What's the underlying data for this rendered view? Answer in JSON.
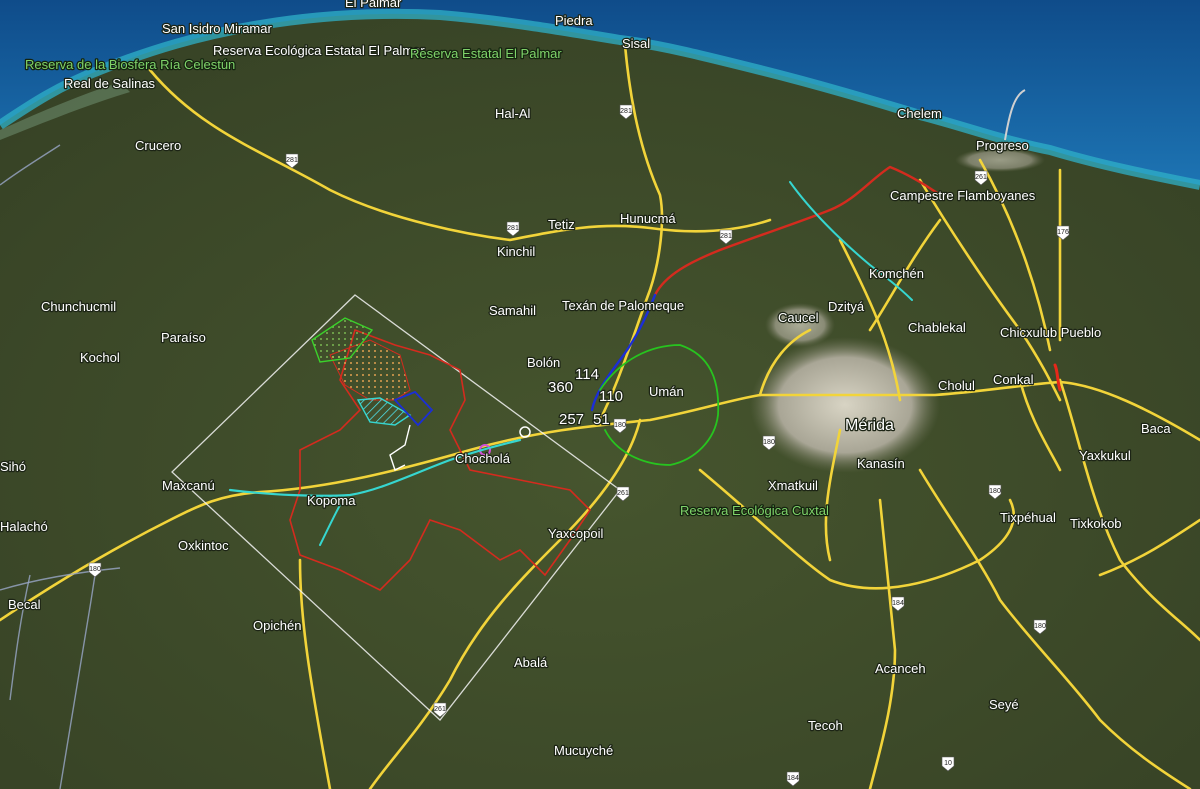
{
  "map": {
    "type": "satellite",
    "colors": {
      "land": "#3d4a2a",
      "sea": "#1a5f9e",
      "coast": "#2a9fc0",
      "road": "#f2d43a",
      "urban": "#c9c6b8",
      "route_red": "#d42b1e",
      "route_blue": "#1b2ed6",
      "route_green": "#27c41f",
      "route_cyan": "#36d6d0",
      "study_area": "#f4f4f4"
    },
    "place_labels": [
      {
        "id": "el-palmar-top",
        "text": "El Palmar"
      },
      {
        "id": "piedra",
        "text": "Piedra"
      },
      {
        "id": "san-isidro",
        "text": "San Isidro Miramar"
      },
      {
        "id": "reserva-el-palmar-ecol",
        "text": "Reserva Ecológica Estatal El Palmar"
      },
      {
        "id": "reserva-estatal-el-palmar",
        "text": "Reserva Estatal El Palmar"
      },
      {
        "id": "sisal",
        "text": "Sisal"
      },
      {
        "id": "reserva-celestun",
        "text": "Reserva de la Biosfera Ría Celestún"
      },
      {
        "id": "real-de-salinas",
        "text": "Real de Salinas"
      },
      {
        "id": "hal-al",
        "text": "Hal-Al"
      },
      {
        "id": "chelem",
        "text": "Chelem"
      },
      {
        "id": "crucero",
        "text": "Crucero"
      },
      {
        "id": "progreso",
        "text": "Progreso"
      },
      {
        "id": "campestre",
        "text": "Campestre Flamboyanes"
      },
      {
        "id": "tetiz",
        "text": "Tetiz"
      },
      {
        "id": "hunucma",
        "text": "Hunucmá"
      },
      {
        "id": "kinchil",
        "text": "Kinchil"
      },
      {
        "id": "komchen",
        "text": "Komchén"
      },
      {
        "id": "chunchucmil",
        "text": "Chunchucmil"
      },
      {
        "id": "samahil",
        "text": "Samahil"
      },
      {
        "id": "texan",
        "text": "Texán de Palomeque"
      },
      {
        "id": "dzitya",
        "text": "Dzityá"
      },
      {
        "id": "caucel",
        "text": "Caucel"
      },
      {
        "id": "chablekal",
        "text": "Chablekal"
      },
      {
        "id": "chicxulub",
        "text": "Chicxulub Pueblo"
      },
      {
        "id": "paraiso",
        "text": "Paraíso"
      },
      {
        "id": "kochol",
        "text": "Kochol"
      },
      {
        "id": "bolon",
        "text": "Bolón"
      },
      {
        "id": "cholul",
        "text": "Cholul"
      },
      {
        "id": "conkal",
        "text": "Conkal"
      },
      {
        "id": "uman",
        "text": "Umán"
      },
      {
        "id": "merida",
        "text": "Mérida"
      },
      {
        "id": "baca",
        "text": "Baca"
      },
      {
        "id": "chochola",
        "text": "Chocholá"
      },
      {
        "id": "kanasin",
        "text": "Kanasín"
      },
      {
        "id": "yaxkukul",
        "text": "Yaxkukul"
      },
      {
        "id": "sího",
        "text": "Sihó"
      },
      {
        "id": "maxcanu",
        "text": "Maxcanú"
      },
      {
        "id": "xmatkuil",
        "text": "Xmatkuil"
      },
      {
        "id": "kopoma",
        "text": "Kopoma"
      },
      {
        "id": "reserva-cuxtal",
        "text": "Reserva Ecológica Cuxtal"
      },
      {
        "id": "tixpehual",
        "text": "Tixpéhual"
      },
      {
        "id": "tixkokob",
        "text": "Tixkokob"
      },
      {
        "id": "halacho",
        "text": "Halachó"
      },
      {
        "id": "oxkintoc",
        "text": "Oxkintoc"
      },
      {
        "id": "yaxcopoil",
        "text": "Yaxcopoil"
      },
      {
        "id": "becal",
        "text": "Becal"
      },
      {
        "id": "opichen",
        "text": "Opichén"
      },
      {
        "id": "abala",
        "text": "Abalá"
      },
      {
        "id": "acanceh",
        "text": "Acanceh"
      },
      {
        "id": "seye",
        "text": "Seyé"
      },
      {
        "id": "tecoh",
        "text": "Tecoh"
      },
      {
        "id": "mucuyche",
        "text": "Mucuyché"
      }
    ],
    "route_numbers": [
      {
        "id": "n114",
        "text": "114"
      },
      {
        "id": "n360",
        "text": "360"
      },
      {
        "id": "n110",
        "text": "110"
      },
      {
        "id": "n257",
        "text": "257"
      },
      {
        "id": "n51",
        "text": "51"
      }
    ],
    "highway_shields": [
      "281",
      "281",
      "281",
      "261",
      "281",
      "176",
      "180",
      "261",
      "180",
      "180",
      "180",
      "184",
      "180",
      "261",
      "184",
      "10"
    ]
  }
}
